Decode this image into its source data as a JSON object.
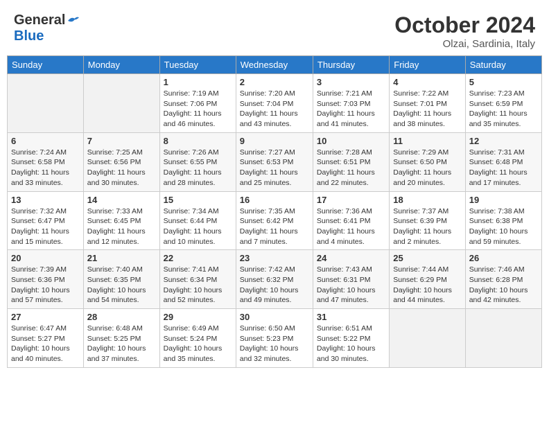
{
  "header": {
    "logo_general": "General",
    "logo_blue": "Blue",
    "month_year": "October 2024",
    "location": "Olzai, Sardinia, Italy"
  },
  "days_of_week": [
    "Sunday",
    "Monday",
    "Tuesday",
    "Wednesday",
    "Thursday",
    "Friday",
    "Saturday"
  ],
  "weeks": [
    [
      {
        "day": "",
        "info": ""
      },
      {
        "day": "",
        "info": ""
      },
      {
        "day": "1",
        "sunrise": "Sunrise: 7:19 AM",
        "sunset": "Sunset: 7:06 PM",
        "daylight": "Daylight: 11 hours and 46 minutes."
      },
      {
        "day": "2",
        "sunrise": "Sunrise: 7:20 AM",
        "sunset": "Sunset: 7:04 PM",
        "daylight": "Daylight: 11 hours and 43 minutes."
      },
      {
        "day": "3",
        "sunrise": "Sunrise: 7:21 AM",
        "sunset": "Sunset: 7:03 PM",
        "daylight": "Daylight: 11 hours and 41 minutes."
      },
      {
        "day": "4",
        "sunrise": "Sunrise: 7:22 AM",
        "sunset": "Sunset: 7:01 PM",
        "daylight": "Daylight: 11 hours and 38 minutes."
      },
      {
        "day": "5",
        "sunrise": "Sunrise: 7:23 AM",
        "sunset": "Sunset: 6:59 PM",
        "daylight": "Daylight: 11 hours and 35 minutes."
      }
    ],
    [
      {
        "day": "6",
        "sunrise": "Sunrise: 7:24 AM",
        "sunset": "Sunset: 6:58 PM",
        "daylight": "Daylight: 11 hours and 33 minutes."
      },
      {
        "day": "7",
        "sunrise": "Sunrise: 7:25 AM",
        "sunset": "Sunset: 6:56 PM",
        "daylight": "Daylight: 11 hours and 30 minutes."
      },
      {
        "day": "8",
        "sunrise": "Sunrise: 7:26 AM",
        "sunset": "Sunset: 6:55 PM",
        "daylight": "Daylight: 11 hours and 28 minutes."
      },
      {
        "day": "9",
        "sunrise": "Sunrise: 7:27 AM",
        "sunset": "Sunset: 6:53 PM",
        "daylight": "Daylight: 11 hours and 25 minutes."
      },
      {
        "day": "10",
        "sunrise": "Sunrise: 7:28 AM",
        "sunset": "Sunset: 6:51 PM",
        "daylight": "Daylight: 11 hours and 22 minutes."
      },
      {
        "day": "11",
        "sunrise": "Sunrise: 7:29 AM",
        "sunset": "Sunset: 6:50 PM",
        "daylight": "Daylight: 11 hours and 20 minutes."
      },
      {
        "day": "12",
        "sunrise": "Sunrise: 7:31 AM",
        "sunset": "Sunset: 6:48 PM",
        "daylight": "Daylight: 11 hours and 17 minutes."
      }
    ],
    [
      {
        "day": "13",
        "sunrise": "Sunrise: 7:32 AM",
        "sunset": "Sunset: 6:47 PM",
        "daylight": "Daylight: 11 hours and 15 minutes."
      },
      {
        "day": "14",
        "sunrise": "Sunrise: 7:33 AM",
        "sunset": "Sunset: 6:45 PM",
        "daylight": "Daylight: 11 hours and 12 minutes."
      },
      {
        "day": "15",
        "sunrise": "Sunrise: 7:34 AM",
        "sunset": "Sunset: 6:44 PM",
        "daylight": "Daylight: 11 hours and 10 minutes."
      },
      {
        "day": "16",
        "sunrise": "Sunrise: 7:35 AM",
        "sunset": "Sunset: 6:42 PM",
        "daylight": "Daylight: 11 hours and 7 minutes."
      },
      {
        "day": "17",
        "sunrise": "Sunrise: 7:36 AM",
        "sunset": "Sunset: 6:41 PM",
        "daylight": "Daylight: 11 hours and 4 minutes."
      },
      {
        "day": "18",
        "sunrise": "Sunrise: 7:37 AM",
        "sunset": "Sunset: 6:39 PM",
        "daylight": "Daylight: 11 hours and 2 minutes."
      },
      {
        "day": "19",
        "sunrise": "Sunrise: 7:38 AM",
        "sunset": "Sunset: 6:38 PM",
        "daylight": "Daylight: 10 hours and 59 minutes."
      }
    ],
    [
      {
        "day": "20",
        "sunrise": "Sunrise: 7:39 AM",
        "sunset": "Sunset: 6:36 PM",
        "daylight": "Daylight: 10 hours and 57 minutes."
      },
      {
        "day": "21",
        "sunrise": "Sunrise: 7:40 AM",
        "sunset": "Sunset: 6:35 PM",
        "daylight": "Daylight: 10 hours and 54 minutes."
      },
      {
        "day": "22",
        "sunrise": "Sunrise: 7:41 AM",
        "sunset": "Sunset: 6:34 PM",
        "daylight": "Daylight: 10 hours and 52 minutes."
      },
      {
        "day": "23",
        "sunrise": "Sunrise: 7:42 AM",
        "sunset": "Sunset: 6:32 PM",
        "daylight": "Daylight: 10 hours and 49 minutes."
      },
      {
        "day": "24",
        "sunrise": "Sunrise: 7:43 AM",
        "sunset": "Sunset: 6:31 PM",
        "daylight": "Daylight: 10 hours and 47 minutes."
      },
      {
        "day": "25",
        "sunrise": "Sunrise: 7:44 AM",
        "sunset": "Sunset: 6:29 PM",
        "daylight": "Daylight: 10 hours and 44 minutes."
      },
      {
        "day": "26",
        "sunrise": "Sunrise: 7:46 AM",
        "sunset": "Sunset: 6:28 PM",
        "daylight": "Daylight: 10 hours and 42 minutes."
      }
    ],
    [
      {
        "day": "27",
        "sunrise": "Sunrise: 6:47 AM",
        "sunset": "Sunset: 5:27 PM",
        "daylight": "Daylight: 10 hours and 40 minutes."
      },
      {
        "day": "28",
        "sunrise": "Sunrise: 6:48 AM",
        "sunset": "Sunset: 5:25 PM",
        "daylight": "Daylight: 10 hours and 37 minutes."
      },
      {
        "day": "29",
        "sunrise": "Sunrise: 6:49 AM",
        "sunset": "Sunset: 5:24 PM",
        "daylight": "Daylight: 10 hours and 35 minutes."
      },
      {
        "day": "30",
        "sunrise": "Sunrise: 6:50 AM",
        "sunset": "Sunset: 5:23 PM",
        "daylight": "Daylight: 10 hours and 32 minutes."
      },
      {
        "day": "31",
        "sunrise": "Sunrise: 6:51 AM",
        "sunset": "Sunset: 5:22 PM",
        "daylight": "Daylight: 10 hours and 30 minutes."
      },
      {
        "day": "",
        "info": ""
      },
      {
        "day": "",
        "info": ""
      }
    ]
  ]
}
